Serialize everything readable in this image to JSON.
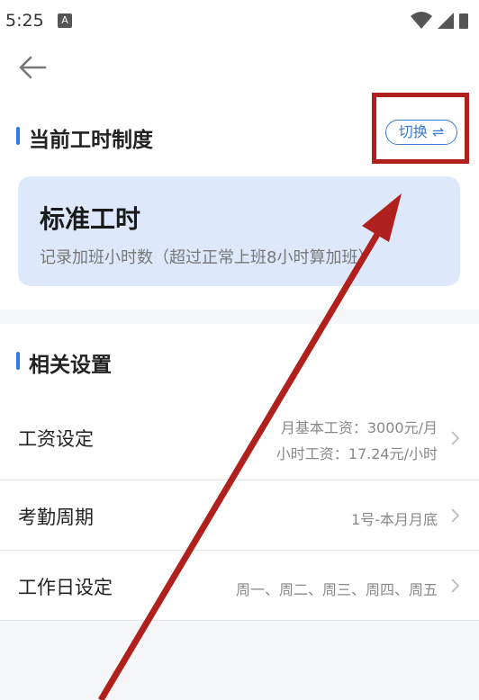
{
  "status_bar": {
    "time": "5:25",
    "notification_icon": "A"
  },
  "header": {
    "back_icon": "back-arrow-icon",
    "current_section_title": "当前工时制度",
    "switch_label": "切换 ⇌"
  },
  "current_mode": {
    "title": "标准工时",
    "description": "记录加班小时数（超过正常上班8小时算加班）"
  },
  "settings": {
    "section_title": "相关设置",
    "rows": [
      {
        "label": "工资设定",
        "value_line1": "月基本工资：3000元/月",
        "value_line2": "小时工资：17.24元/小时"
      },
      {
        "label": "考勤周期",
        "value": "1号-本月月底"
      },
      {
        "label": "工作日设定",
        "value": "周一、周二、周三、周四、周五"
      }
    ]
  },
  "colors": {
    "accent": "#3a7bd5",
    "card_bg": "#dde9fb",
    "annotation": "#b0201c"
  }
}
